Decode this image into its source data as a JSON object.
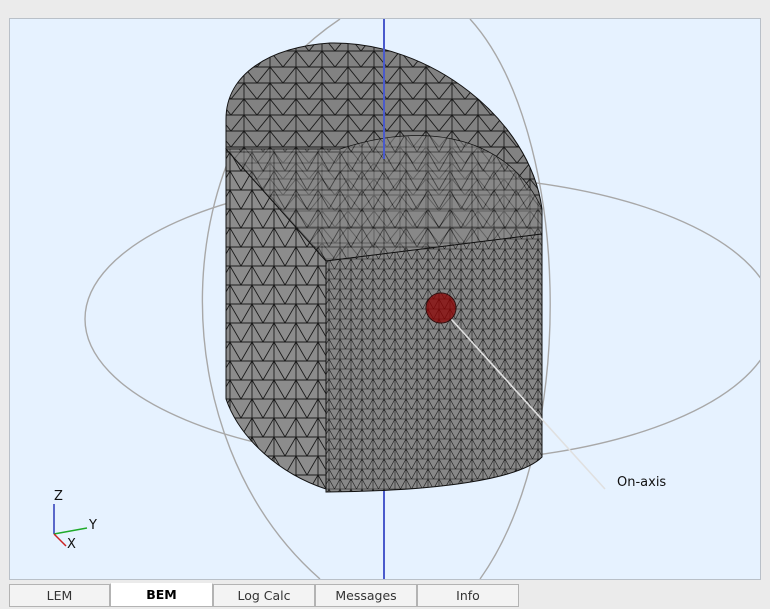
{
  "viewport": {
    "background": "#e6f2ff",
    "annotation": "On-axis",
    "triad": {
      "z": "Z",
      "y": "Y",
      "x": "X"
    },
    "mesh_color": "#8a8a8a",
    "sphere_color": "#8b0000",
    "axis_color": "#4a5acc"
  },
  "tabs": [
    {
      "label": "LEM",
      "active": false
    },
    {
      "label": "BEM",
      "active": true
    },
    {
      "label": "Log Calc",
      "active": false
    },
    {
      "label": "Messages",
      "active": false
    },
    {
      "label": "Info",
      "active": false
    }
  ]
}
